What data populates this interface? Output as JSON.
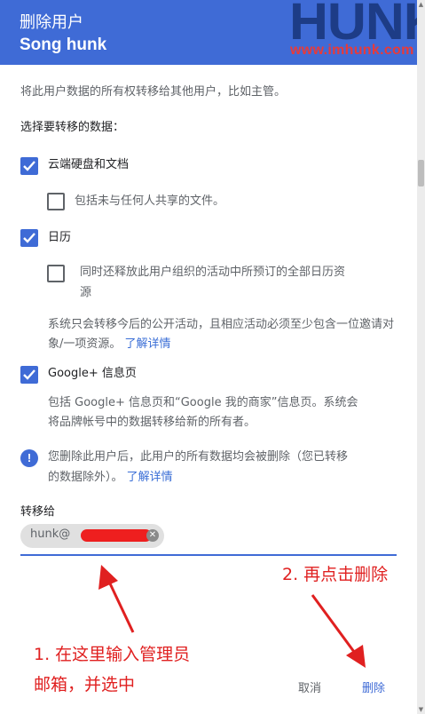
{
  "dialog": {
    "title": "删除用户",
    "user_name": "Song hunk",
    "intro": "将此用户数据的所有权转移给其他用户，比如主管。",
    "section_label": "选择要转移的数据："
  },
  "watermark": {
    "logo": "HUNK",
    "url": "www.imhunk.com"
  },
  "options": {
    "drive": {
      "label": "云端硬盘和文档",
      "checked": true
    },
    "drive_unshared": {
      "label": "包括未与任何人共享的文件。",
      "checked": false
    },
    "calendar": {
      "label": "日历",
      "checked": true
    },
    "calendar_release": {
      "line1": "同时还释放此用户组织的活动中所预订的全部日历资",
      "line2": "源",
      "checked": false
    },
    "calendar_note": {
      "line1": "系统只会转移今后的公开活动，且相应活动必须至少包含一位邀请对",
      "line2": "象/一项资源。",
      "link": "了解详情"
    },
    "google_plus": {
      "label": "Google+ 信息页",
      "checked": true
    },
    "google_plus_note": {
      "line1": "包括 Google+ 信息页和“Google 我的商家”信息页。系统会",
      "line2": "将品牌帐号中的数据转移给新的所有者。"
    }
  },
  "warning": {
    "line1": "您删除此用户后，此用户的所有数据均会被删除（您已转移",
    "line2": "的数据除外）。",
    "link": "了解详情"
  },
  "transfer": {
    "label": "转移给",
    "chip_text": "hunk@"
  },
  "annotations": {
    "step2": "2. 再点击删除",
    "step1_line1": "1. 在这里输入管理员",
    "step1_line2": "邮箱，并选中"
  },
  "actions": {
    "cancel": "取消",
    "delete": "删除"
  },
  "colors": {
    "accent": "#3f6bd6",
    "annotation": "#e02020",
    "redaction": "#ee1f1f"
  }
}
